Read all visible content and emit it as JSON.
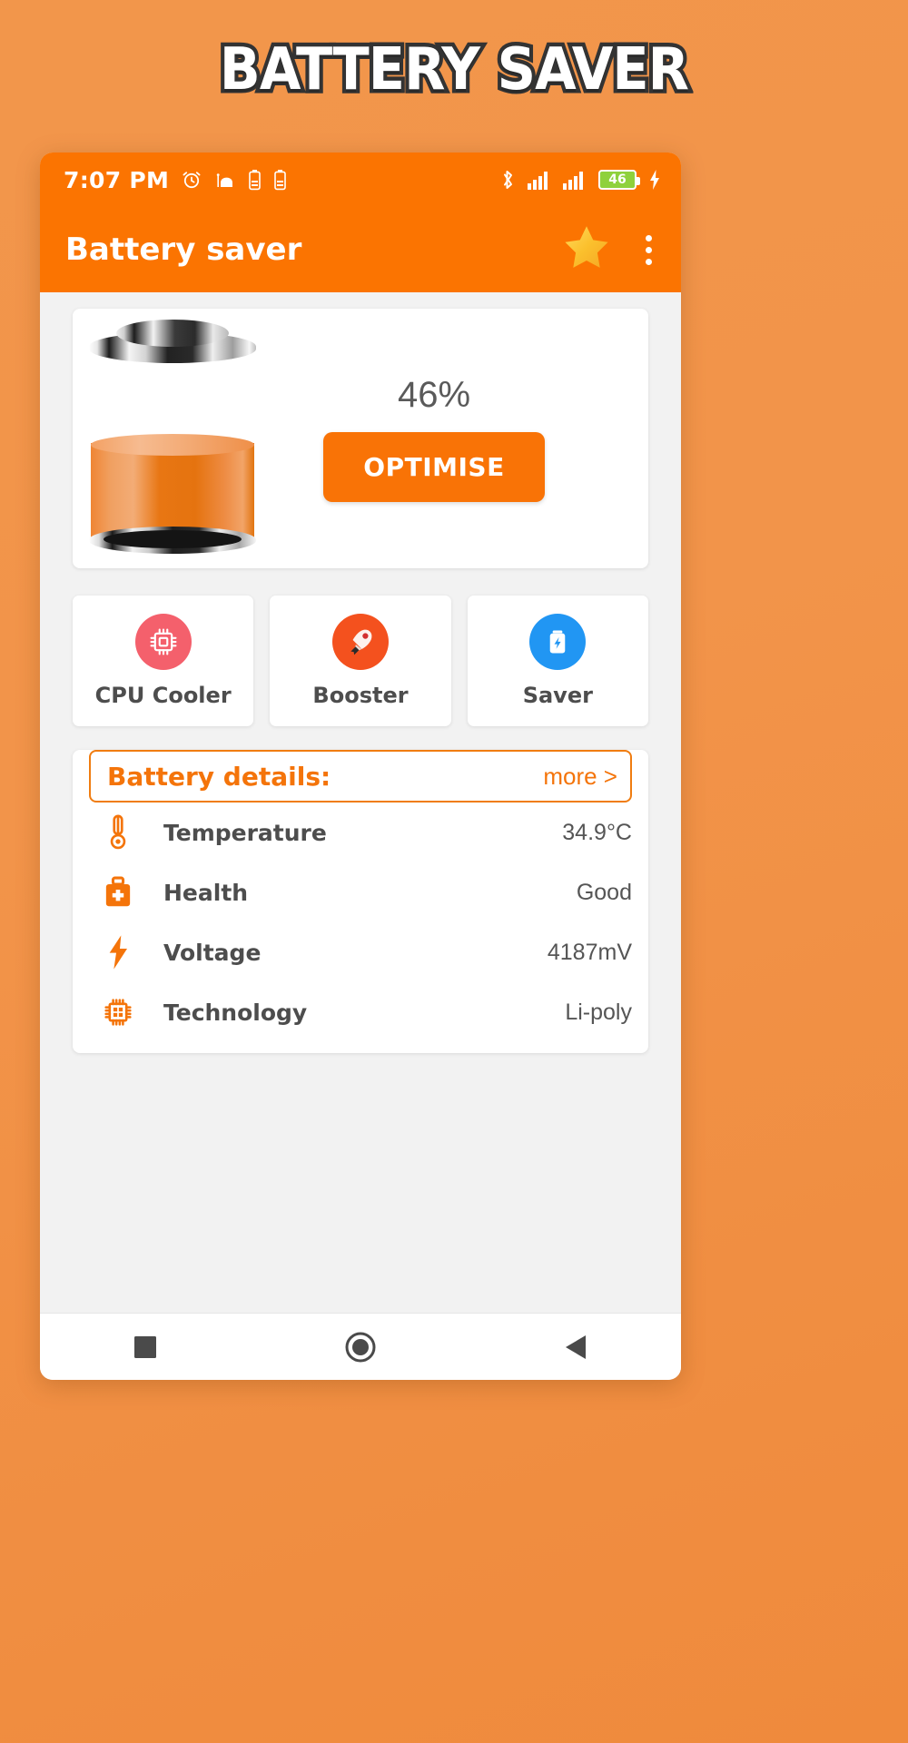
{
  "poster": {
    "title": "BATTERY SAVER"
  },
  "colors": {
    "background": "#f2944a",
    "accent": "#fb7401",
    "accent_text": "#f4740a",
    "cpu_icon_bg": "#f4606c",
    "booster_icon_bg": "#f4511e",
    "saver_icon_bg": "#2196f3",
    "battery_badge": "#8fd13c"
  },
  "statusbar": {
    "time": "7:07 PM",
    "battery_percent": "46",
    "left_icons": [
      "alarm-clock-icon",
      "mosque-icon",
      "battery-icon",
      "battery-icon"
    ],
    "right_icons": [
      "bluetooth-icon",
      "signal-bars-icon",
      "signal-bars-icon",
      "battery-badge-icon",
      "charging-bolt-icon"
    ]
  },
  "appbar": {
    "title": "Battery saver",
    "star_icon": "star-icon",
    "overflow_icon": "overflow-menu-icon"
  },
  "hero": {
    "percent": "46%",
    "optimise_label": "OPTIMISE"
  },
  "tiles": [
    {
      "label": "CPU Cooler",
      "icon": "cpu-chip-icon"
    },
    {
      "label": "Booster",
      "icon": "rocket-icon"
    },
    {
      "label": "Saver",
      "icon": "battery-bolt-icon"
    }
  ],
  "details": {
    "title": "Battery details:",
    "more_label": "more >",
    "rows": [
      {
        "icon": "thermometer-icon",
        "label": "Temperature",
        "value": "34.9°C"
      },
      {
        "icon": "medical-kit-icon",
        "label": "Health",
        "value": "Good"
      },
      {
        "icon": "lightning-bolt-icon",
        "label": "Voltage",
        "value": "4187mV"
      },
      {
        "icon": "chip-icon",
        "label": "Technology",
        "value": "Li-poly"
      }
    ]
  },
  "navbar": {
    "recents_icon": "square-recents-icon",
    "home_icon": "circle-home-icon",
    "back_icon": "triangle-back-icon"
  }
}
